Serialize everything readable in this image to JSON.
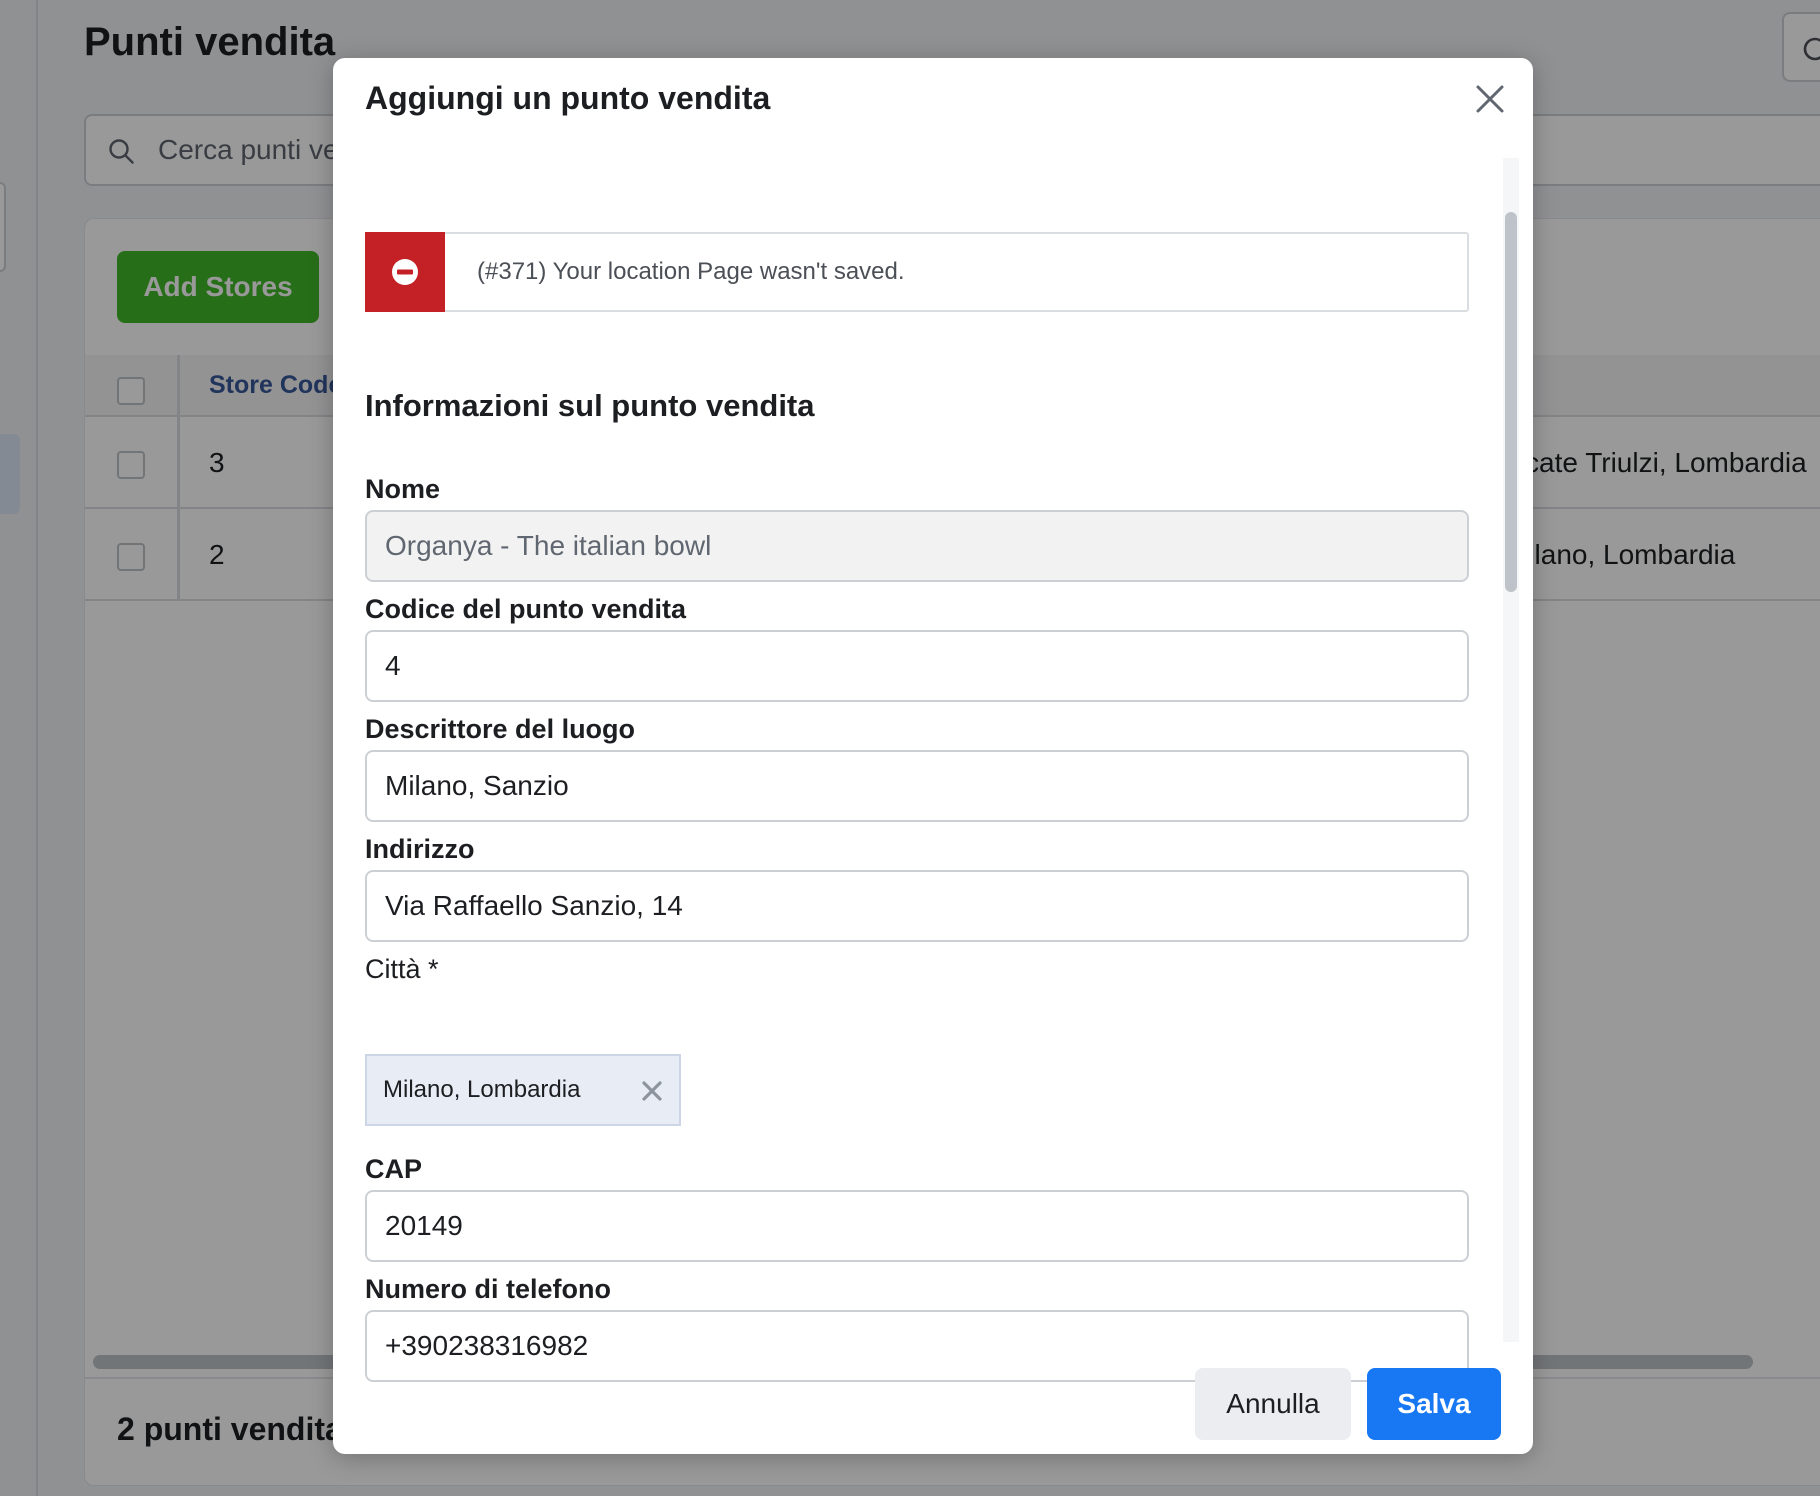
{
  "background": {
    "page_title": "Punti vendita",
    "search_placeholder": "Cerca punti ve",
    "add_button": "Add Stores",
    "table": {
      "column_store_code": "Store Code",
      "rows": [
        {
          "store_code": "3",
          "city": "cate Triulzi, Lombardia"
        },
        {
          "store_code": "2",
          "city": "Milano, Lombardia"
        }
      ]
    },
    "footer_count": "2 punti vendita"
  },
  "modal": {
    "title": "Aggiungi un punto vendita",
    "error_message": "(#371) Your location Page wasn't saved.",
    "section_title": "Informazioni sul punto vendita",
    "fields": {
      "name": {
        "label": "Nome",
        "value": "Organya - The italian bowl"
      },
      "store_code": {
        "label": "Codice del punto vendita",
        "value": "4"
      },
      "location_descriptor": {
        "label": "Descrittore del luogo",
        "value": "Milano, Sanzio"
      },
      "address": {
        "label": "Indirizzo",
        "value": "Via Raffaello Sanzio, 14"
      },
      "city": {
        "label": "Città *",
        "value": "Milano, Lombardia"
      },
      "zip": {
        "label": "CAP",
        "value": "20149"
      },
      "phone": {
        "label": "Numero di telefono",
        "value": "+390238316982"
      }
    },
    "buttons": {
      "cancel": "Annulla",
      "save": "Salva"
    }
  },
  "colors": {
    "error_red": "#c42127",
    "primary_blue": "#1877f2",
    "add_green": "#42b72a",
    "link_blue": "#385898"
  }
}
